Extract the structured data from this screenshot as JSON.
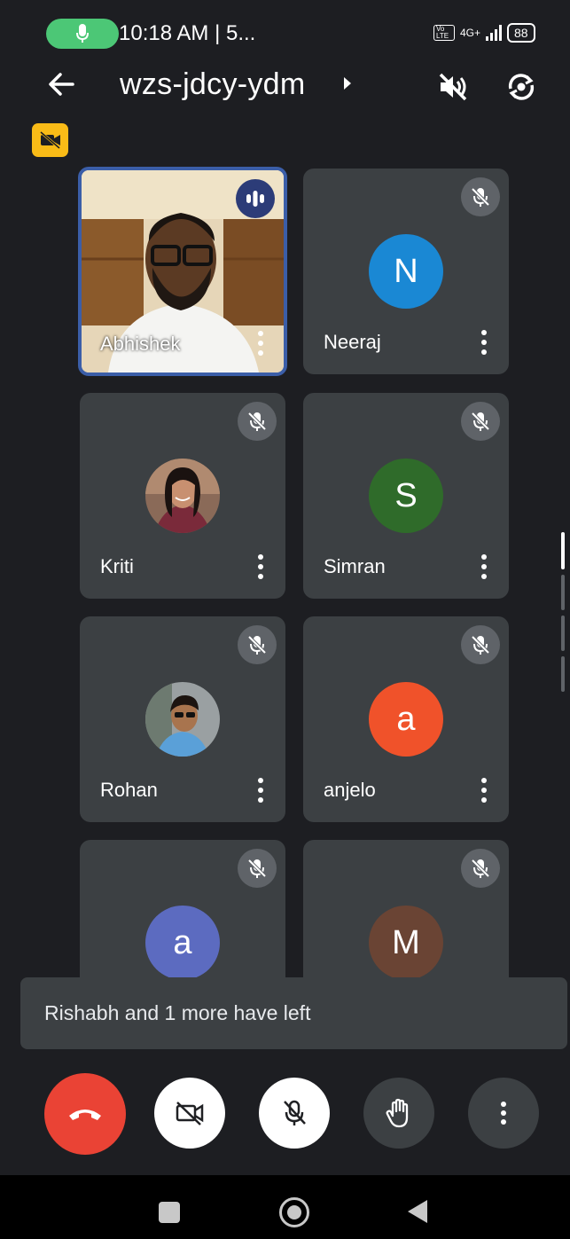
{
  "status_bar": {
    "time": "10:18 AM | 5...",
    "volte": "Vo LTE",
    "network": "4G+",
    "battery": "88",
    "icons": [
      "mic-icon",
      "signal-icon",
      "battery-icon"
    ]
  },
  "header": {
    "meeting_code": "wzs-jdcy-ydm",
    "icons": [
      "back-arrow-icon",
      "caret-right-icon",
      "speaker-off-icon",
      "switch-camera-icon",
      "camera-off-badge-icon"
    ]
  },
  "participants": [
    {
      "name": "Abhishek",
      "type": "video",
      "speaking": true
    },
    {
      "name": "Neeraj",
      "type": "initial",
      "initial": "N",
      "color": "#1a88d4",
      "muted": true
    },
    {
      "name": "Kriti",
      "type": "photo",
      "muted": true
    },
    {
      "name": "Simran",
      "type": "initial",
      "initial": "S",
      "color": "#2f6b2a",
      "muted": true
    },
    {
      "name": "Rohan",
      "type": "photo",
      "muted": true
    },
    {
      "name": "anjelo",
      "type": "initial",
      "initial": "a",
      "color": "#f0522a",
      "muted": true
    },
    {
      "name": "",
      "type": "initial",
      "initial": "a",
      "color": "#5c6bc0",
      "muted": true
    },
    {
      "name": "",
      "type": "initial",
      "initial": "M",
      "color": "#6a4434",
      "muted": true
    }
  ],
  "toast": {
    "message": "Rishabh and 1 more have left"
  },
  "controls": {
    "icons": [
      "hang-up-icon",
      "camera-off-icon",
      "mic-off-icon",
      "raise-hand-icon",
      "more-vert-icon"
    ]
  },
  "nav": {
    "icons": [
      "recents-icon",
      "home-icon",
      "back-icon"
    ]
  },
  "colors": {
    "background": "#1d1e22",
    "tile": "#3c4043",
    "hangup": "#ea4335",
    "active_border": "#3b5ea8",
    "badge": "#f9bb17",
    "mic_pill": "#4cc776"
  }
}
